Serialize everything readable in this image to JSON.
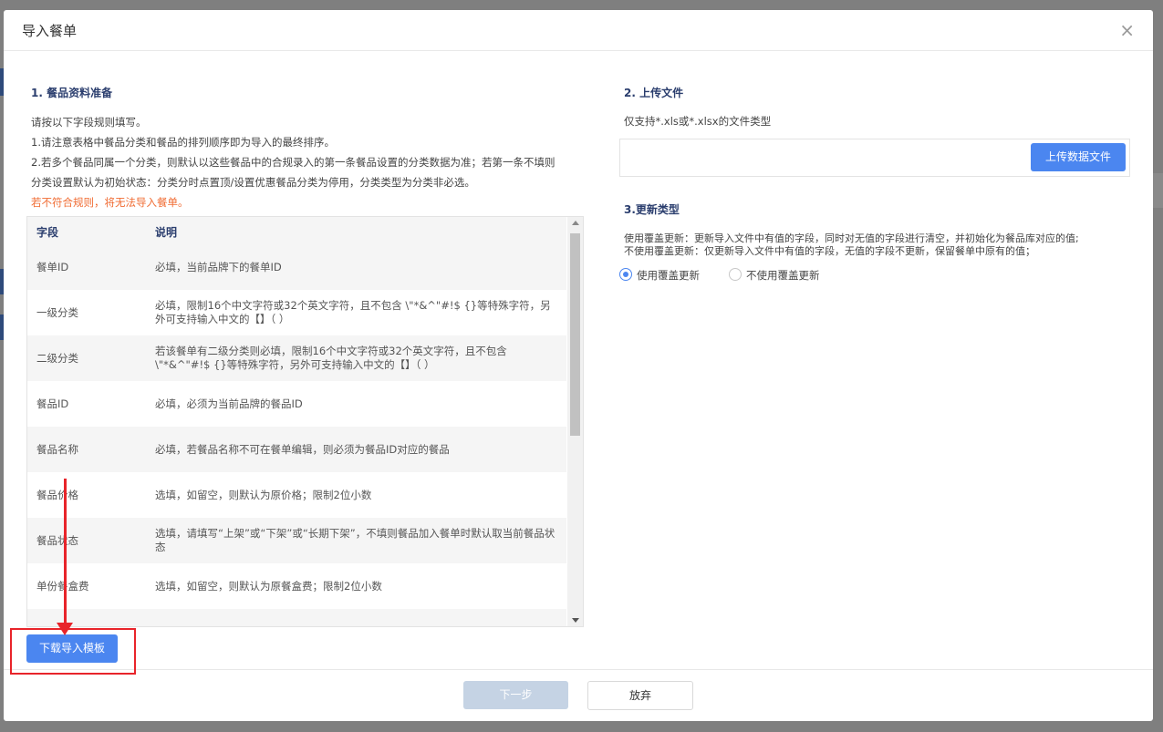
{
  "modal": {
    "title": "导入餐单",
    "close_label": "×"
  },
  "left": {
    "section_title": "1. 餐品资料准备",
    "intro": "请按以下字段规则填写。",
    "rule1": "1.请注意表格中餐品分类和餐品的排列顺序即为导入的最终排序。",
    "rule2_line1": "2.若多个餐品同属一个分类，则默认以这些餐品中的合规录入的第一条餐品设置的分类数据为准；若第一条不填则",
    "rule2_line2": "分类设置默认为初始状态：分类分时点置顶/设置优惠餐品分类为停用，分类类型为分类非必选。",
    "warning": "若不符合规则，将无法导入餐单。",
    "table": {
      "headers": {
        "field": "字段",
        "desc": "说明"
      },
      "rows": [
        {
          "field": "餐单ID",
          "desc": "必填，当前品牌下的餐单ID"
        },
        {
          "field": "一级分类",
          "desc": "必填，限制16个中文字符或32个英文字符，且不包含 \\\"*&^\"#!$ {}等特殊字符，另外可支持输入中文的【】（ ）"
        },
        {
          "field": "二级分类",
          "desc": "若该餐单有二级分类则必填，限制16个中文字符或32个英文字符，且不包含 \\\"*&^\"#!$ {}等特殊字符，另外可支持输入中文的【】（ ）"
        },
        {
          "field": "餐品ID",
          "desc": "必填，必须为当前品牌的餐品ID"
        },
        {
          "field": "餐品名称",
          "desc": "必填，若餐品名称不可在餐单编辑，则必须为餐品ID对应的餐品"
        },
        {
          "field": "餐品价格",
          "desc": "选填，如留空，则默认为原价格；限制2位小数"
        },
        {
          "field": "餐品状态",
          "desc": "选填，请填写“上架”或“下架”或“长期下架”，不填则餐品加入餐单时默认取当前餐品状态"
        },
        {
          "field": "单份餐盒费",
          "desc": "选填，如留空，则默认为原餐盒费；限制2位小数"
        },
        {
          "field": "",
          "desc": ""
        }
      ]
    },
    "download_button": "下载导入模板"
  },
  "right": {
    "upload_title": "2. 上传文件",
    "upload_hint": "仅支持*.xls或*.xlsx的文件类型",
    "upload_button": "上传数据文件",
    "update_title": "3.更新类型",
    "update_desc1": "使用覆盖更新：更新导入文件中有值的字段，同时对无值的字段进行清空，并初始化为餐品库对应的值;",
    "update_desc2": "不使用覆盖更新：仅更新导入文件中有值的字段，无值的字段不更新，保留餐单中原有的值；",
    "options": [
      {
        "label": "使用覆盖更新",
        "selected": true
      },
      {
        "label": "不使用覆盖更新",
        "selected": false
      }
    ]
  },
  "footer": {
    "next_label": "下一步",
    "abandon_label": "放弃"
  },
  "colors": {
    "primary": "#4b86f0",
    "warning": "#f06b32",
    "annotation": "#e8242a",
    "title": "#2b3e6e"
  }
}
